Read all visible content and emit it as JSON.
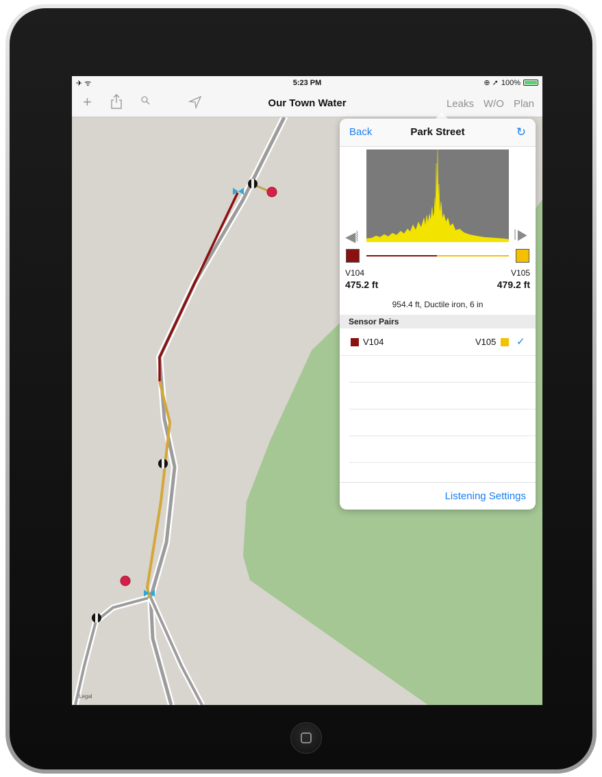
{
  "status_bar": {
    "left_icons": "✈ ᯤ",
    "time": "5:23 PM",
    "right_icons": "⊕ ➚",
    "battery_text": "100%",
    "battery_level": 1.0
  },
  "nav_bar": {
    "title": "Our Town Water",
    "left_icons": [
      "add-icon",
      "share-icon",
      "search-icon",
      "location-icon"
    ],
    "tabs": [
      {
        "label": "Leaks"
      },
      {
        "label": "W/O"
      },
      {
        "label": "Plan"
      }
    ]
  },
  "map": {
    "legal": "Legal",
    "colors": {
      "land": "#d8d4ce",
      "park": "#a4c794",
      "leak_segment": "#8b1010",
      "pipe_segment": "#d4a73a",
      "valve": "#2fa6d6",
      "marker_red": "#d6204a"
    }
  },
  "popover": {
    "back_label": "Back",
    "title": "Park Street",
    "refresh_icon": "refresh-icon",
    "left_sensor": {
      "name": "V104",
      "distance": "475.2 ft",
      "color": "#8b1010"
    },
    "right_sensor": {
      "name": "V105",
      "distance": "479.2 ft",
      "color": "#f5c000"
    },
    "pipe_info": "954.4 ft, Ductile iron, 6 in",
    "section_header": "Sensor Pairs",
    "pairs": [
      {
        "left": "V104",
        "right": "V105",
        "selected": true
      }
    ],
    "footer_link": "Listening Settings"
  }
}
